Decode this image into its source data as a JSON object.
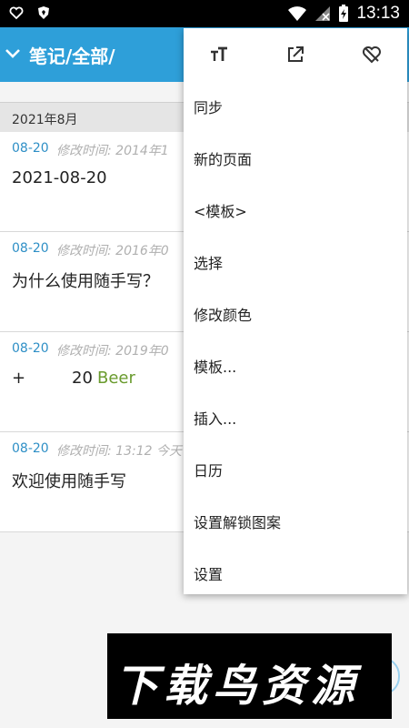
{
  "statusbar": {
    "time": "13:13"
  },
  "appbar": {
    "title": "笔记/全部/"
  },
  "list": {
    "date_header": "2021年8月",
    "notes": [
      {
        "date": "08-20",
        "modified": "修改时间: 2014年1",
        "title": "2021-08-20"
      },
      {
        "date": "08-20",
        "modified": "修改时间: 2016年0",
        "title": "为什么使用随手写？"
      },
      {
        "date": "08-20",
        "modified": "修改时间: 2019年0",
        "plus": "+",
        "number": "20",
        "beer": "Beer"
      },
      {
        "date": "08-20",
        "modified": "修改时间: 13:12 今天",
        "title": "欢迎使用随手写"
      }
    ]
  },
  "menu": {
    "items": [
      {
        "label": "同步"
      },
      {
        "label": "新的页面"
      },
      {
        "label": "<模板>"
      },
      {
        "label": "选择"
      },
      {
        "label": "修改颜色"
      },
      {
        "label": "模板..."
      },
      {
        "label": "插入..."
      },
      {
        "label": "日历"
      },
      {
        "label": "设置解锁图案"
      },
      {
        "label": "设置"
      }
    ]
  },
  "banner": {
    "text": "下载鸟资源"
  },
  "colors": {
    "accent": "#2e9fd9",
    "date": "#2e8fc6",
    "beer": "#6a9b2e"
  }
}
